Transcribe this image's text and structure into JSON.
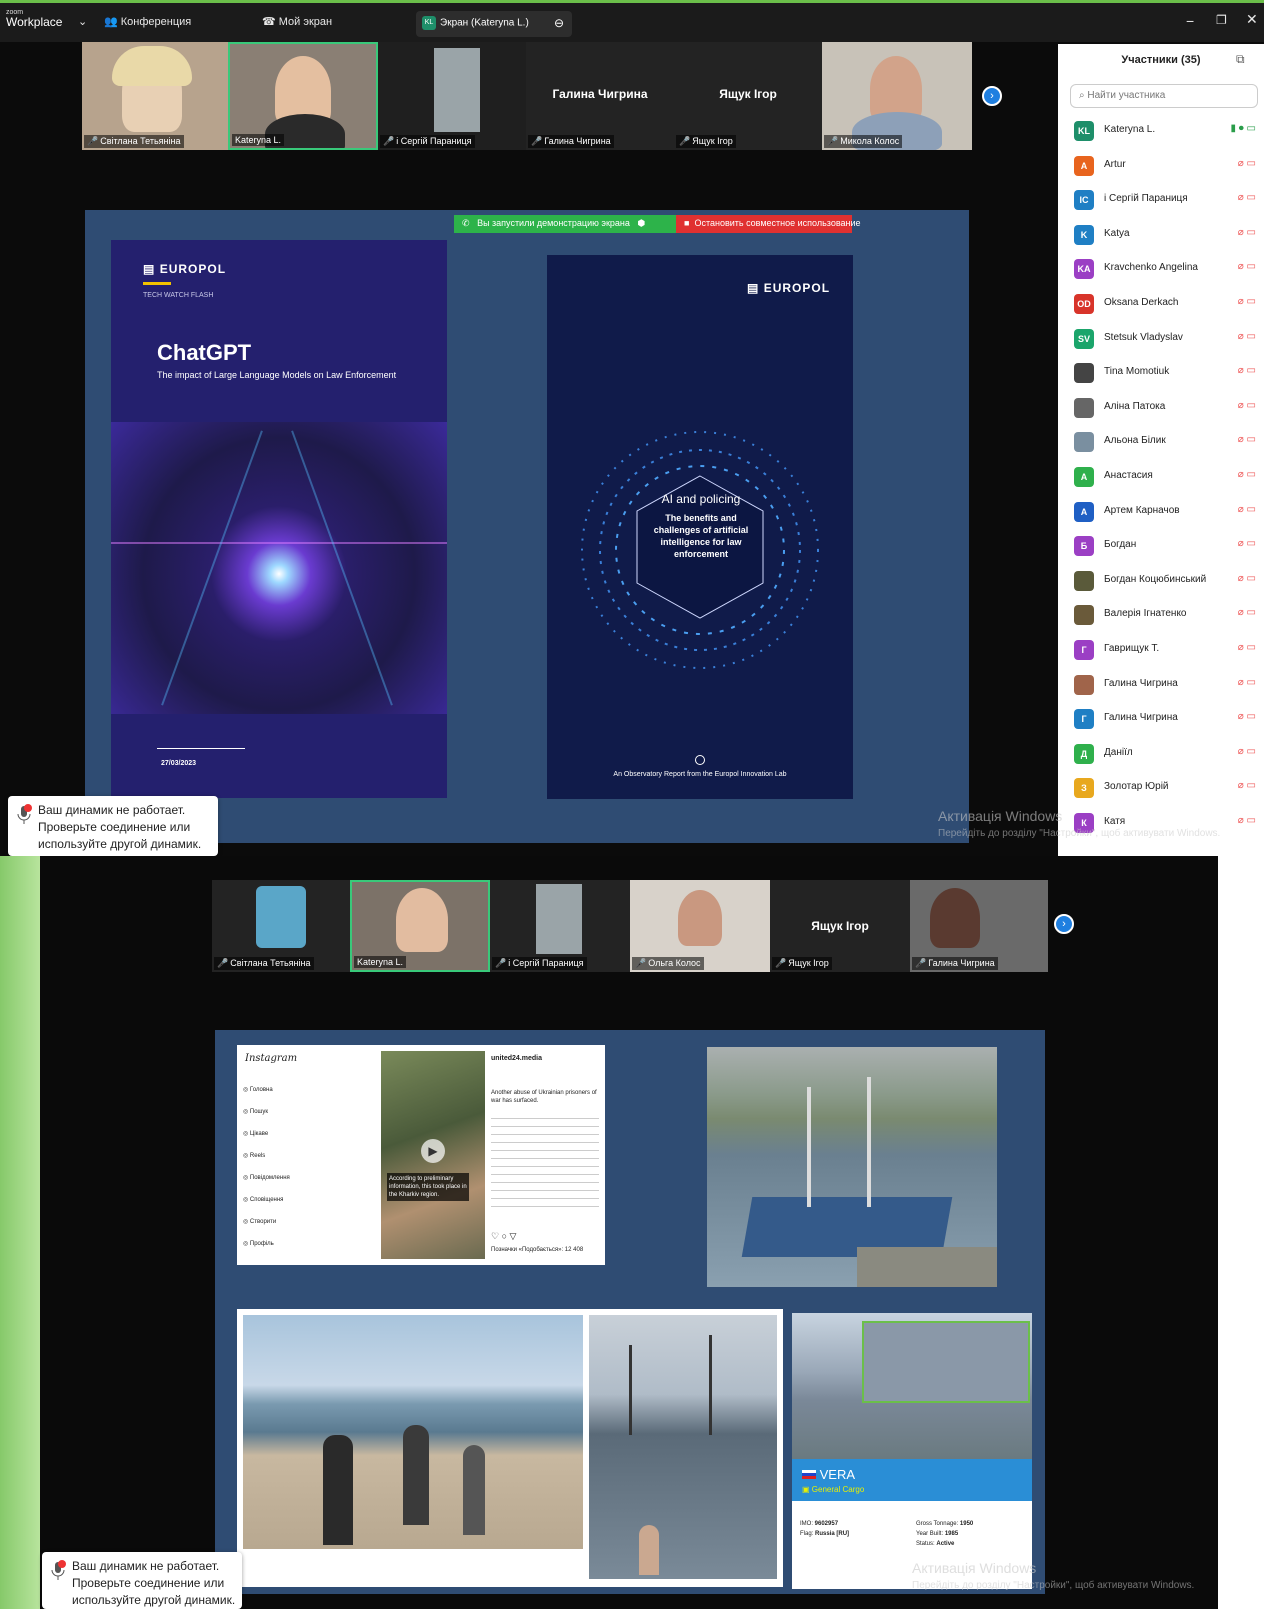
{
  "window": {
    "app_logo_small": "zoom",
    "app_logo": "Workplace",
    "menu_conference": "Конференция",
    "menu_my_screen": "Мой экран",
    "screen_tab": "Экран (Kateryna L.)",
    "screen_tab_badge": "KL"
  },
  "top_gallery": [
    {
      "name": "Світлана Тетьяніна",
      "muted": true
    },
    {
      "name": "Kateryna L.",
      "muted": false,
      "active": true
    },
    {
      "name": "і Сергій Параниця",
      "muted": true
    },
    {
      "name": "Галина Чигрина",
      "muted": true,
      "big": "Галина Чигрина"
    },
    {
      "name": "Ящук Ігор",
      "muted": true,
      "big": "Ящук Ігор"
    },
    {
      "name": "Микола Колос",
      "muted": true
    }
  ],
  "share_banner": {
    "started": "Вы запустили демонстрацию экрана",
    "stop": "Остановить совместное использование"
  },
  "doc1": {
    "brand": "EUROPOL",
    "subtitle": "TECH WATCH FLASH",
    "title": "ChatGPT",
    "tagline": "The impact of Large Language Models on Law Enforcement",
    "date": "27/03/2023"
  },
  "doc2": {
    "brand": "EUROPOL",
    "heading": "AI and policing",
    "body": "The benefits and challenges of artificial intelligence for law enforcement",
    "footer": "An Observatory Report from the Europol Innovation Lab"
  },
  "participants": {
    "title": "Участники (35)",
    "search_placeholder": "Найти участника",
    "list": [
      {
        "initials": "KL",
        "name": "Kateryna L.",
        "color": "#1e8f6a"
      },
      {
        "initials": "A",
        "name": "Artur",
        "color": "#e8641e"
      },
      {
        "initials": "IC",
        "name": "і Сергій Параниця",
        "color": "#1f7fc4"
      },
      {
        "initials": "K",
        "name": "Katya",
        "color": "#1f7fc4"
      },
      {
        "initials": "KA",
        "name": "Kravchenko Angelina",
        "color": "#9b3fc4"
      },
      {
        "initials": "OD",
        "name": "Oksana Derkach",
        "color": "#d8342a"
      },
      {
        "initials": "SV",
        "name": "Stetsuk Vladyslav",
        "color": "#1ba56b"
      },
      {
        "initials": "",
        "name": "Tina Momotiuk",
        "color": "#444"
      },
      {
        "initials": "",
        "name": "Аліна Патока",
        "color": "#666"
      },
      {
        "initials": "",
        "name": "Альона Білик",
        "color": "#7a8fa0"
      },
      {
        "initials": "А",
        "name": "Анастасия",
        "color": "#2fb04c"
      },
      {
        "initials": "А",
        "name": "Артем Карначов",
        "color": "#1f5fc4"
      },
      {
        "initials": "Б",
        "name": "Богдан",
        "color": "#9b3fc4"
      },
      {
        "initials": "",
        "name": "Богдан Коцюбинський",
        "color": "#5a5a3a"
      },
      {
        "initials": "",
        "name": "Валерія Ігнатенко",
        "color": "#6a5a3a"
      },
      {
        "initials": "Г",
        "name": "Гаврищук Т.",
        "color": "#9b3fc4"
      },
      {
        "initials": "",
        "name": "Галина Чигрина",
        "color": "#a0644a"
      },
      {
        "initials": "Г",
        "name": "Галина Чигрина",
        "color": "#1f7fc4"
      },
      {
        "initials": "Д",
        "name": "Даніїл",
        "color": "#2fb04c"
      },
      {
        "initials": "З",
        "name": "Золотар Юрій",
        "color": "#e8a81e"
      },
      {
        "initials": "К",
        "name": "Катя",
        "color": "#9b3fc4"
      }
    ]
  },
  "toast": {
    "line1": "Ваш динамик не работает.",
    "line2": "Проверьте соединение или",
    "line3": "используйте другой динамик."
  },
  "watermark": {
    "title": "Активація Windows",
    "hint_top": "Перейдіть до розділу \"Настройки\", щоб активувати Windows.",
    "hint_bottom": "Перейдіть до розділу \"Настройки\", щоб активувати Windows."
  },
  "bottom_gallery": [
    {
      "name": "Світлана Тетьяніна",
      "muted": true
    },
    {
      "name": "Kateryna L.",
      "muted": false,
      "active": true
    },
    {
      "name": "і Сергій Параниця",
      "muted": true
    },
    {
      "name": "Ольга Колос",
      "muted": true
    },
    {
      "name": "Ящук Ігор",
      "muted": true,
      "big": "Ящук Ігор"
    },
    {
      "name": "Галина Чигрина",
      "muted": true
    }
  ],
  "instagram": {
    "logo": "Instagram",
    "nav": [
      "Головна",
      "Пошук",
      "Цікаве",
      "Reels",
      "Повідомлення",
      "Сповіщення",
      "Створити",
      "Профіль"
    ],
    "account": "united24.media",
    "video_caption": "According to preliminary information, this took place in the Kharkiv region.",
    "post_text": "Another abuse of Ukrainian prisoners of war has surfaced.",
    "likes": "Позначки «Подобається»: 12 408"
  },
  "vessel": {
    "name": "VERA",
    "type": "General Cargo",
    "imo_label": "IMO:",
    "imo": "9602957",
    "flag_label": "Flag:",
    "flag": "Russia [RU]",
    "gross_label": "Gross Tonnage:",
    "gross": "1950",
    "year_label": "Year Built:",
    "year": "1985",
    "status_label": "Status:",
    "status": "Active"
  }
}
